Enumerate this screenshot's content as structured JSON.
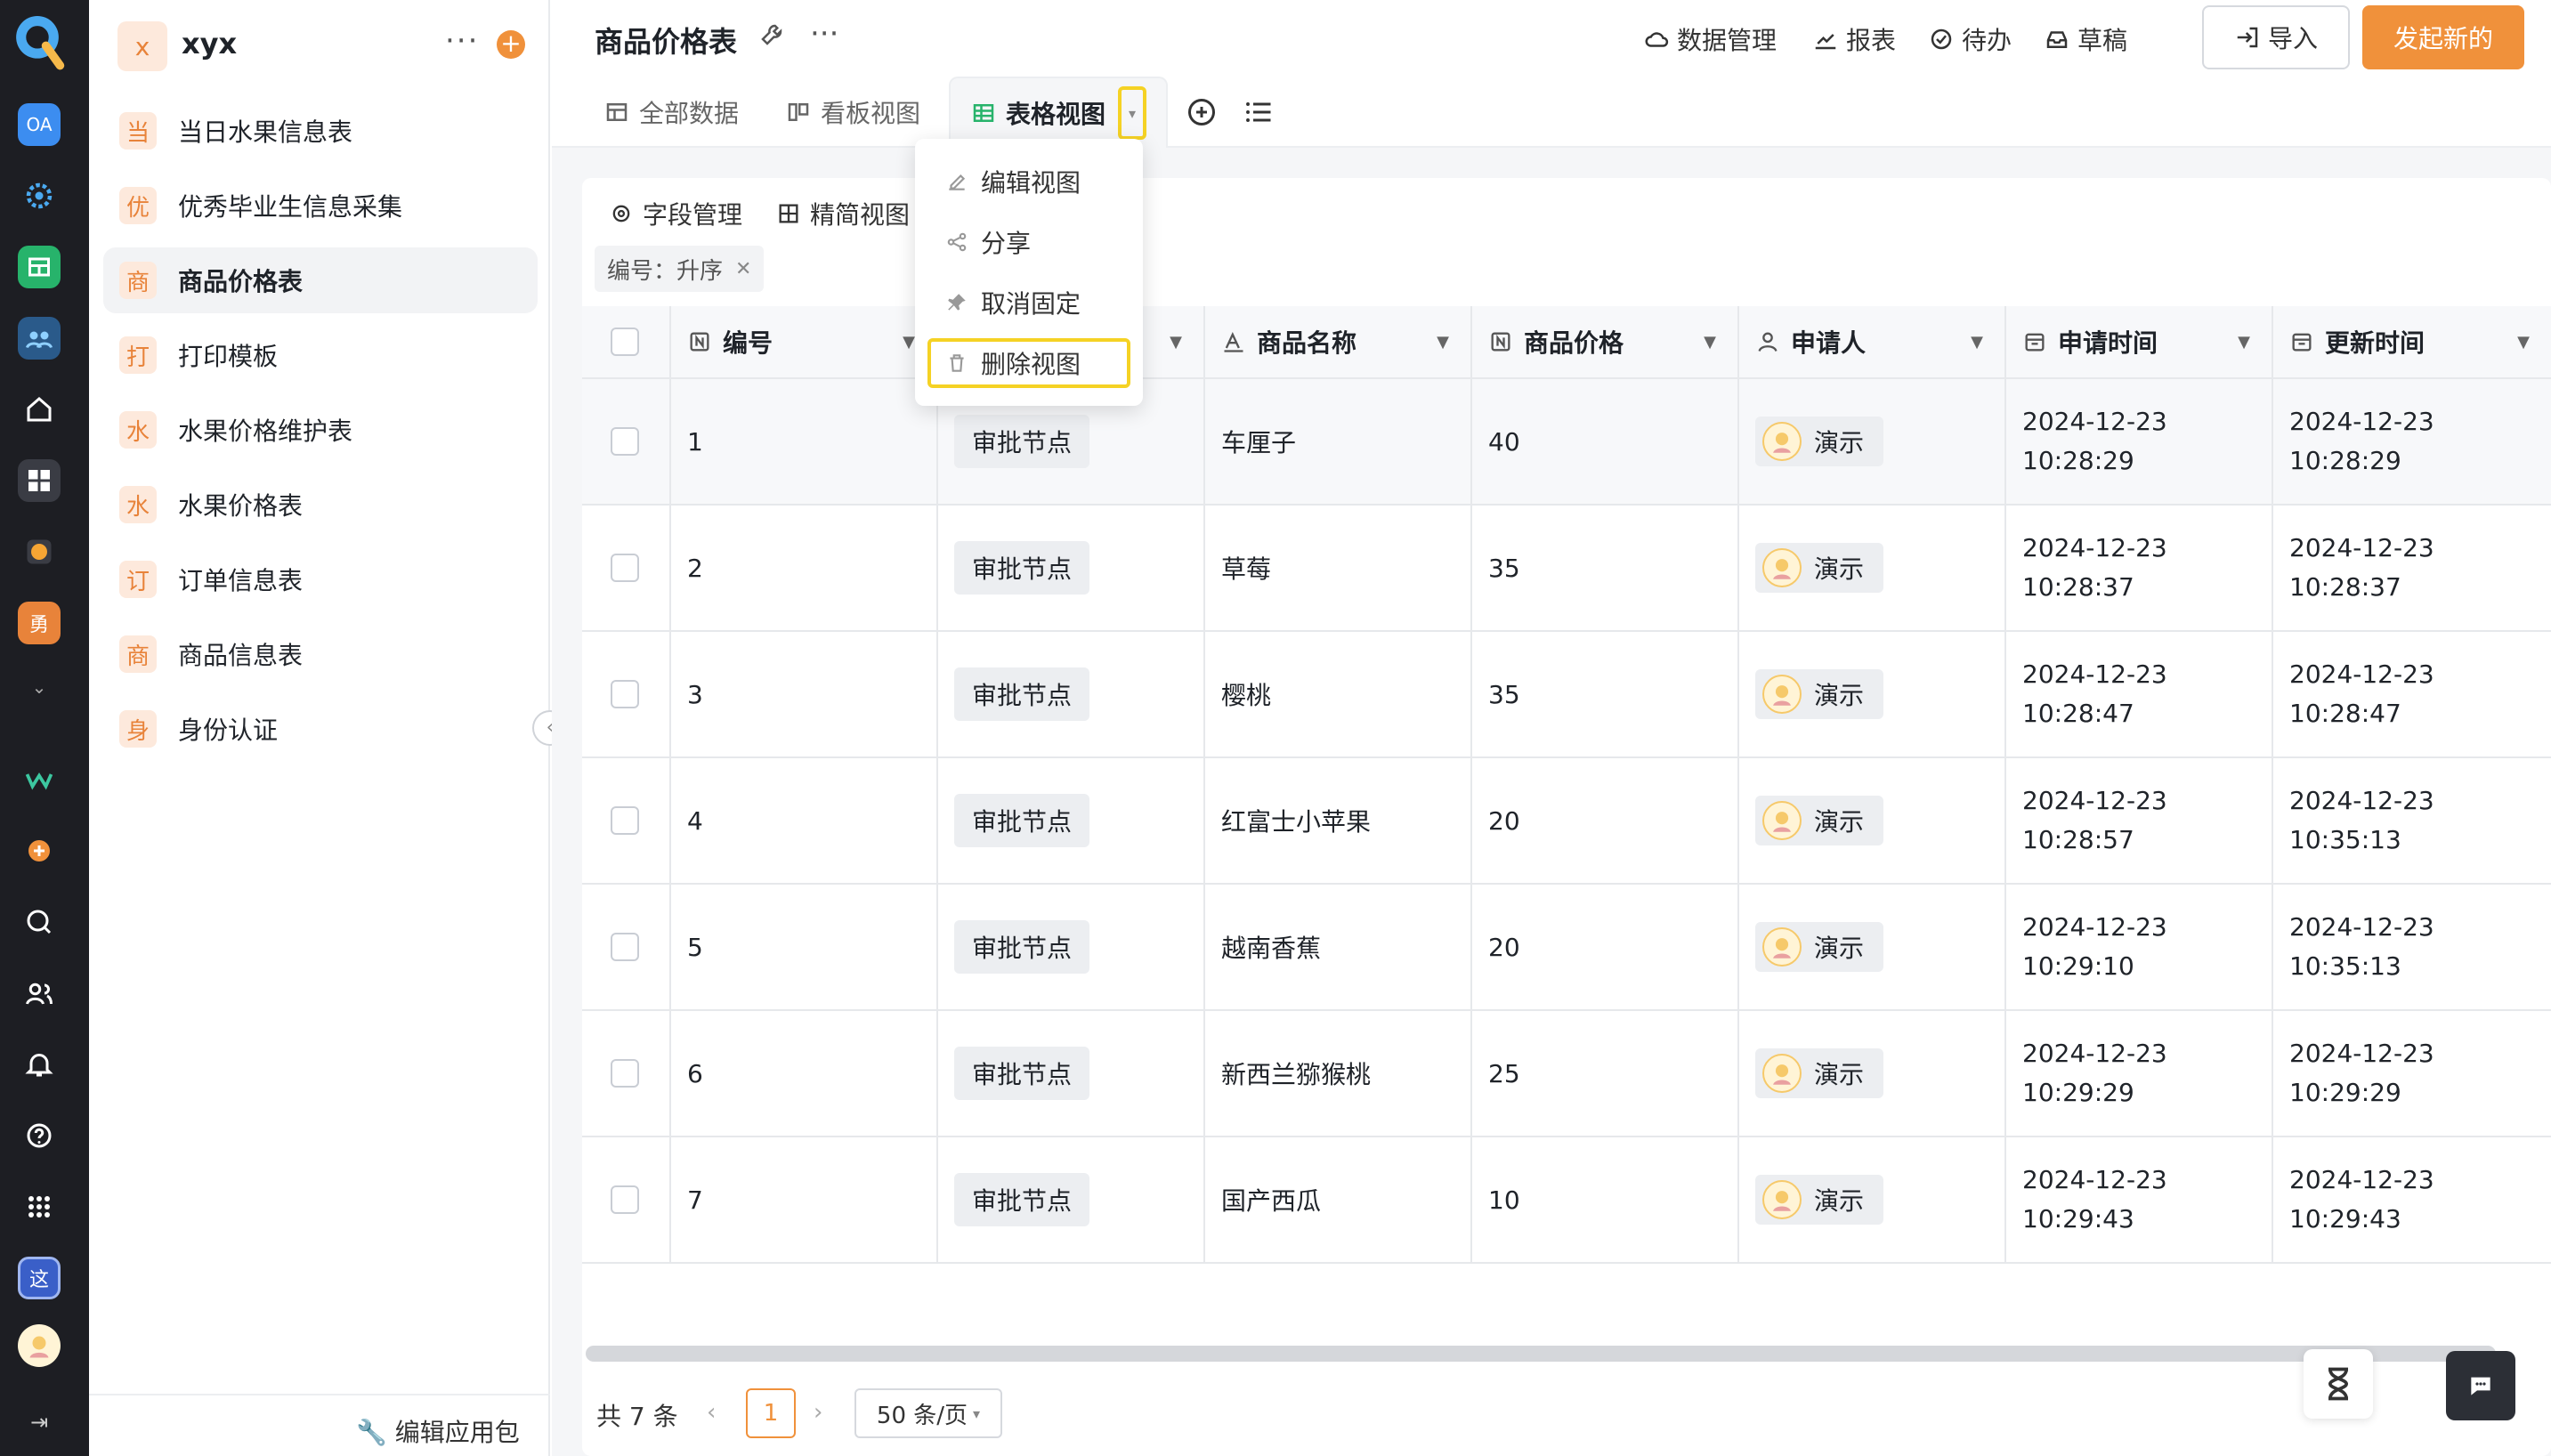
{
  "app": {
    "name": "xyx",
    "avatar_letter": "x"
  },
  "sidebar": {
    "items": [
      {
        "badge": "当",
        "label": "当日水果信息表"
      },
      {
        "badge": "优",
        "label": "优秀毕业生信息采集"
      },
      {
        "badge": "商",
        "label": "商品价格表"
      },
      {
        "badge": "打",
        "label": "打印模板"
      },
      {
        "badge": "水",
        "label": "水果价格维护表"
      },
      {
        "badge": "水",
        "label": "水果价格表"
      },
      {
        "badge": "订",
        "label": "订单信息表"
      },
      {
        "badge": "商",
        "label": "商品信息表"
      },
      {
        "badge": "身",
        "label": "身份认证"
      }
    ],
    "active_index": 2,
    "footer_label": "编辑应用包"
  },
  "header": {
    "title": "商品价格表",
    "actions": [
      "数据管理",
      "报表",
      "待办",
      "草稿"
    ],
    "import_label": "导入",
    "launch_label": "发起新的"
  },
  "tabs": [
    {
      "label": "全部数据"
    },
    {
      "label": "看板视图"
    },
    {
      "label": "表格视图"
    }
  ],
  "active_tab": "表格视图",
  "toolbar": {
    "field_manage": "字段管理",
    "compact_view": "精简视图"
  },
  "sort_chip": "编号：升序",
  "dropdown_menu": [
    "编辑视图",
    "分享",
    "取消固定",
    "删除视图"
  ],
  "dropdown_highlight": "删除视图",
  "table": {
    "columns": [
      "编号",
      "",
      "商品名称",
      "商品价格",
      "申请人",
      "申请时间",
      "更新时间"
    ],
    "rows": [
      {
        "id": "1",
        "node": "审批节点",
        "name": "车厘子",
        "price": "40",
        "applicant": "演示",
        "applied": "2024-12-23 10:28:29",
        "updated": "2024-12-23 10:28:29"
      },
      {
        "id": "2",
        "node": "审批节点",
        "name": "草莓",
        "price": "35",
        "applicant": "演示",
        "applied": "2024-12-23 10:28:37",
        "updated": "2024-12-23 10:28:37"
      },
      {
        "id": "3",
        "node": "审批节点",
        "name": "樱桃",
        "price": "35",
        "applicant": "演示",
        "applied": "2024-12-23 10:28:47",
        "updated": "2024-12-23 10:28:47"
      },
      {
        "id": "4",
        "node": "审批节点",
        "name": "红富士小苹果",
        "price": "20",
        "applicant": "演示",
        "applied": "2024-12-23 10:28:57",
        "updated": "2024-12-23 10:35:13"
      },
      {
        "id": "5",
        "node": "审批节点",
        "name": "越南香蕉",
        "price": "20",
        "applicant": "演示",
        "applied": "2024-12-23 10:29:10",
        "updated": "2024-12-23 10:35:13"
      },
      {
        "id": "6",
        "node": "审批节点",
        "name": "新西兰猕猴桃",
        "price": "25",
        "applicant": "演示",
        "applied": "2024-12-23 10:29:29",
        "updated": "2024-12-23 10:29:29"
      },
      {
        "id": "7",
        "node": "审批节点",
        "name": "国产西瓜",
        "price": "10",
        "applicant": "演示",
        "applied": "2024-12-23 10:29:43",
        "updated": "2024-12-23 10:29:43"
      }
    ]
  },
  "pagination": {
    "total_text": "共 7 条",
    "current_page": "1",
    "page_size": "50 条/页"
  },
  "rail_icons": [
    "logo-icon",
    "oa-icon",
    "settings-gear-icon",
    "sheet-icon",
    "team-icon",
    "home-icon",
    "apps-grid-icon",
    "smile-icon",
    "brave-icon",
    "chevron-down-icon",
    "wave-icon",
    "add-circle-icon",
    "search-icon",
    "contacts-icon",
    "bell-icon",
    "help-icon",
    "launcher-icon",
    "this-icon",
    "user-avatar-icon",
    "expand-icon"
  ],
  "rail_labels": {
    "oa": "OA",
    "brave": "勇",
    "this": "这"
  },
  "colors": {
    "accent": "#f0913b",
    "highlight": "#f5d224",
    "rail": "#1d1e23"
  }
}
